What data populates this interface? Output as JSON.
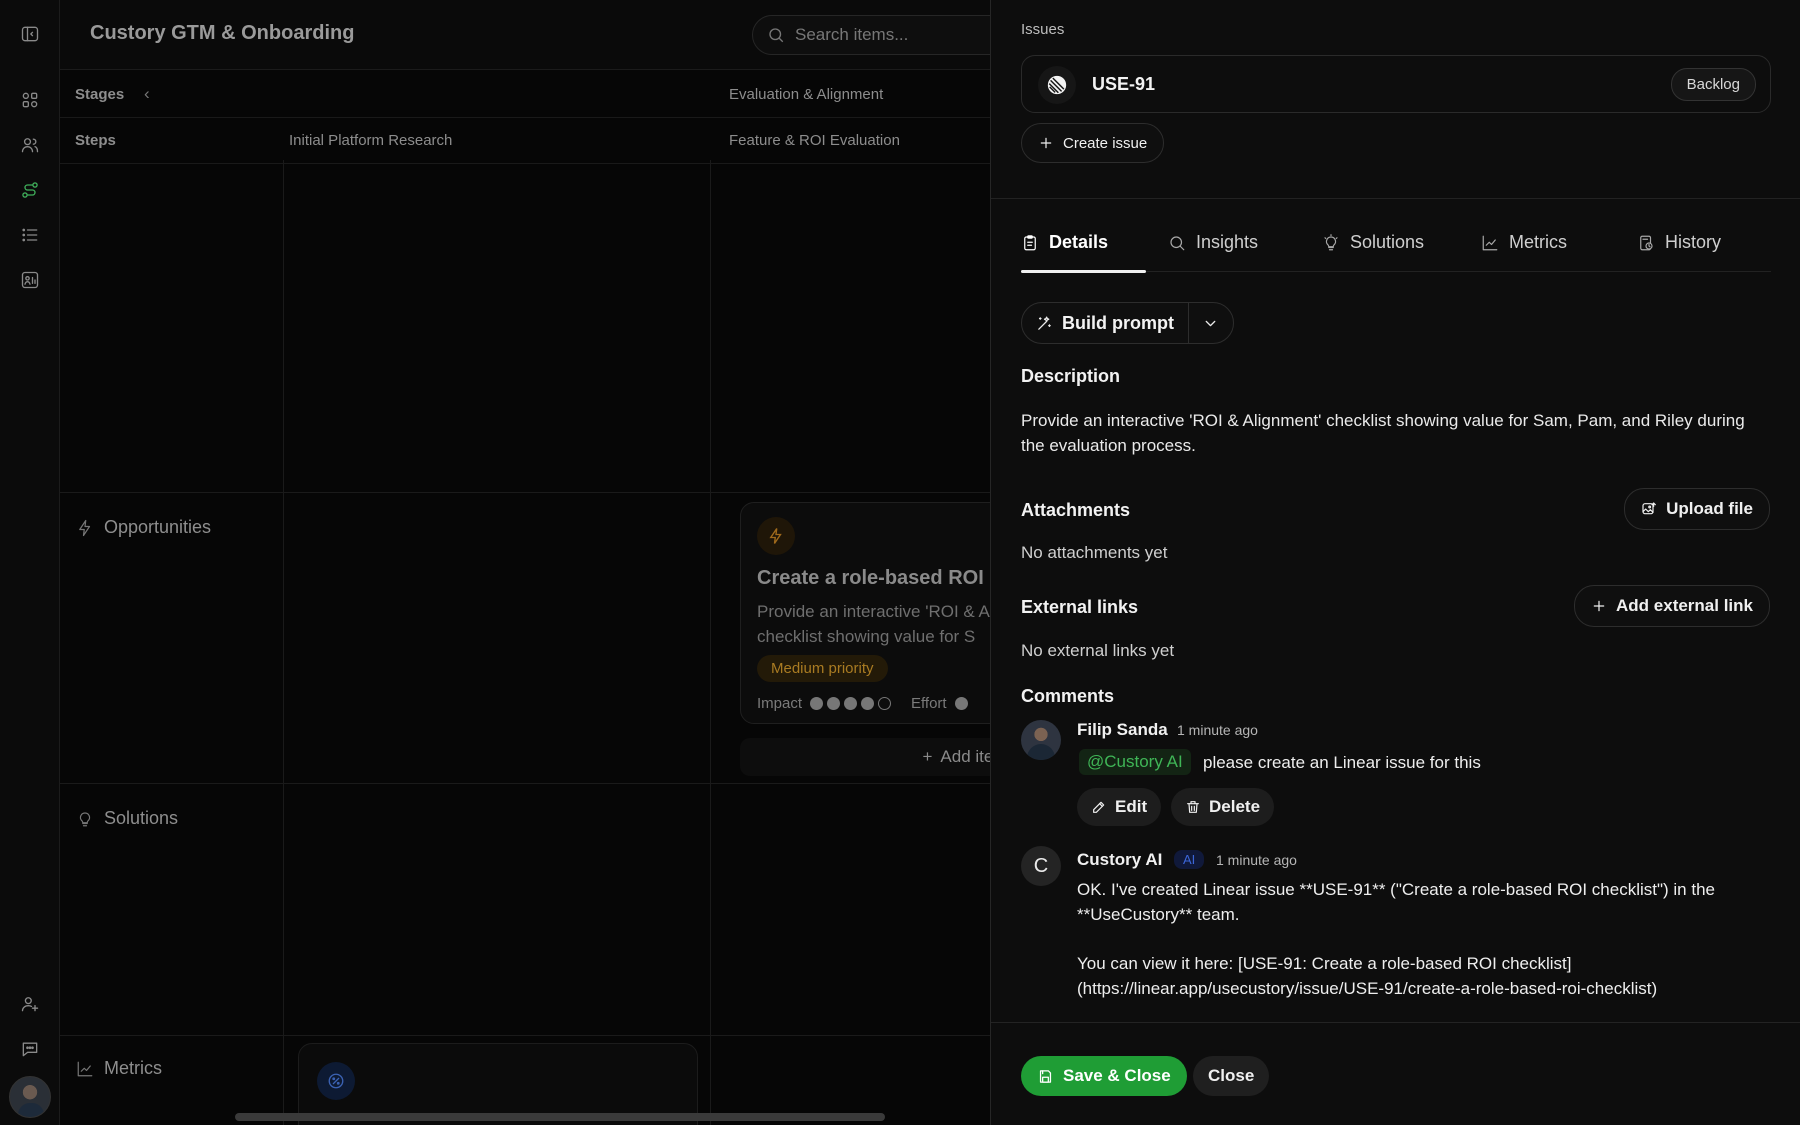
{
  "app": {
    "title": "Custory GTM & Onboarding",
    "search_placeholder": "Search items..."
  },
  "board": {
    "stages_label": "Stages",
    "steps_label": "Steps",
    "stage_names": [
      "Evaluation & Alignment"
    ],
    "step_names": [
      "Initial Platform Research",
      "Feature & ROI Evaluation"
    ],
    "sections": [
      "Opportunities",
      "Solutions",
      "Metrics"
    ],
    "card": {
      "title": "Create a role-based ROI c",
      "desc_line1": "Provide an interactive 'ROI & A",
      "desc_line2": "checklist showing value for S",
      "priority": "Medium priority",
      "impact_label": "Impact",
      "impact_level": 4,
      "impact_max": 5,
      "effort_label": "Effort"
    },
    "add_item_label": "Add item"
  },
  "panel": {
    "issues_label": "Issues",
    "issue": {
      "key": "USE-91",
      "status": "Backlog"
    },
    "create_issue_label": "Create issue",
    "tabs": [
      {
        "label": "Details",
        "icon": "clipboard-icon",
        "active": true
      },
      {
        "label": "Insights",
        "icon": "search-icon",
        "active": false
      },
      {
        "label": "Solutions",
        "icon": "lightbulb-icon",
        "active": false
      },
      {
        "label": "Metrics",
        "icon": "chart-icon",
        "active": false
      },
      {
        "label": "History",
        "icon": "history-icon",
        "active": false
      }
    ],
    "build_prompt_label": "Build prompt",
    "description_heading": "Description",
    "description_text": "Provide an interactive 'ROI & Alignment' checklist showing value for Sam, Pam, and Riley during the evaluation process.",
    "attachments_heading": "Attachments",
    "upload_file_label": "Upload file",
    "no_attachments": "No attachments yet",
    "external_links_heading": "External links",
    "add_external_link_label": "Add external link",
    "no_external_links": "No external links yet",
    "comments_heading": "Comments",
    "comments": [
      {
        "author": "Filip Sanda",
        "time": "1 minute ago",
        "mention": "@Custory AI",
        "text": "please create an Linear issue for this",
        "edit_label": "Edit",
        "delete_label": "Delete"
      },
      {
        "author": "Custory AI",
        "avatar_letter": "C",
        "badge": "AI",
        "time": "1 minute ago",
        "line1": "OK. I've created Linear issue **USE-91** (\"Create a role-based ROI checklist\") in the",
        "line2": "**UseCustory** team.",
        "line3": "You can view it here: [USE-91: Create a role-based ROI checklist]",
        "line4": "(https://linear.app/usecustory/issue/USE-91/create-a-role-based-roi-checklist)"
      }
    ],
    "save_close_label": "Save & Close",
    "close_label": "Close"
  },
  "colors": {
    "accent_green": "#1f9d35",
    "mention_green": "#3fb556",
    "ai_blue": "#3c66d8",
    "priority_amber": "#a97b22"
  }
}
